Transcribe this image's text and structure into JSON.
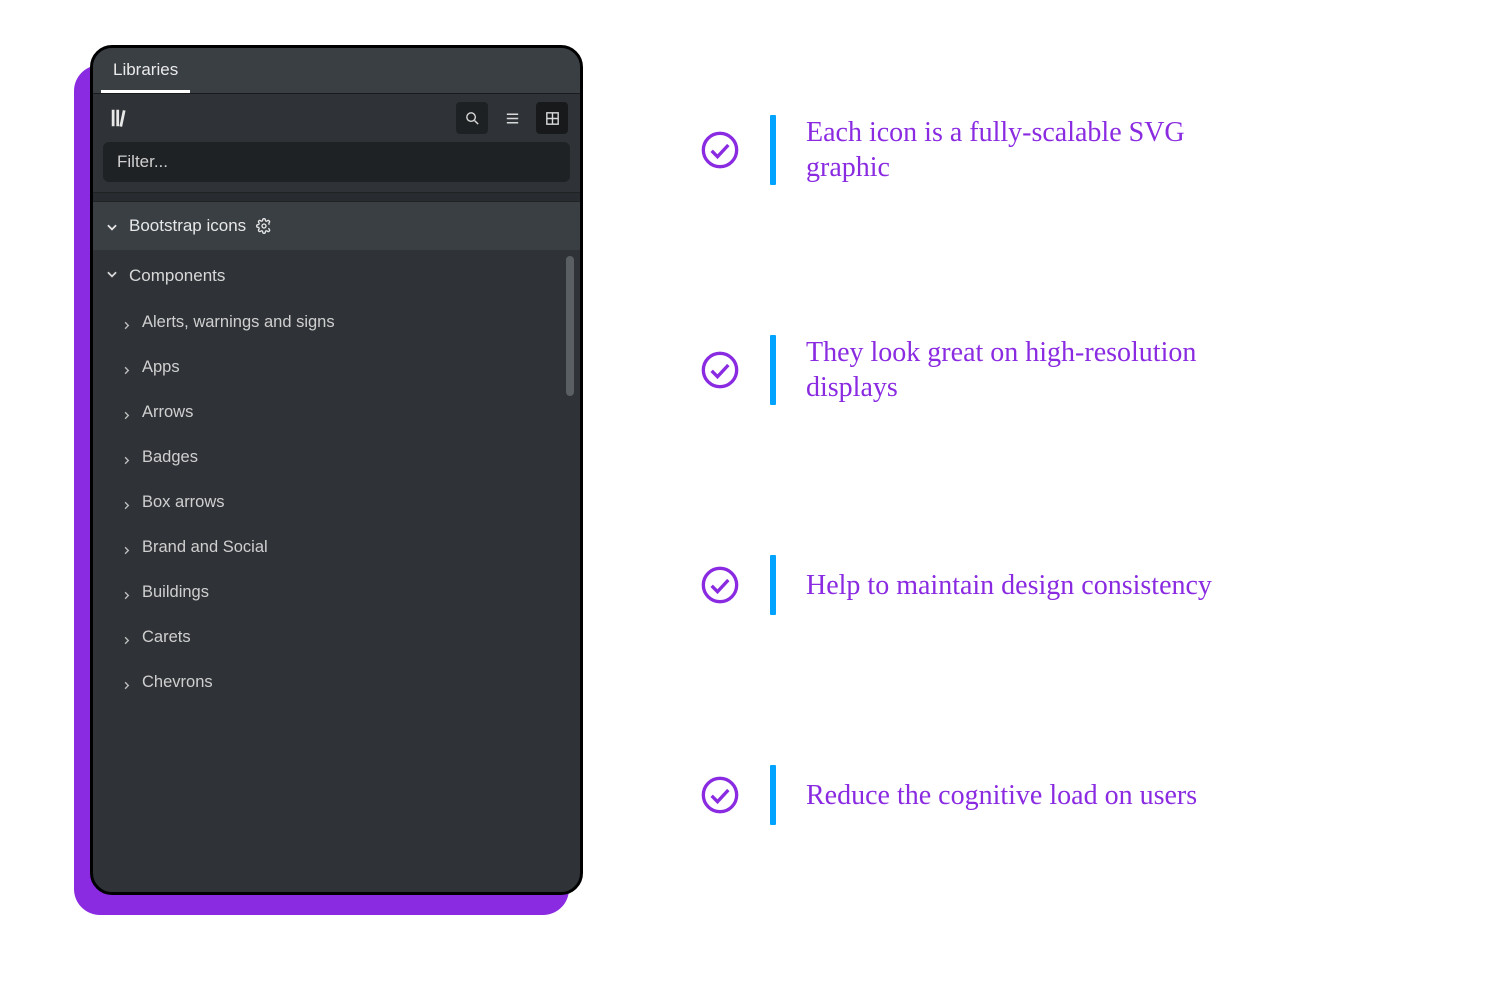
{
  "colors": {
    "purple": "#8a2be2",
    "accent_blue": "#00a3ff",
    "panel_bg": "#2f3337"
  },
  "panel": {
    "tab_label": "Libraries",
    "filter_placeholder": "Filter...",
    "section": {
      "label": "Bootstrap icons"
    },
    "group": {
      "label": "Components",
      "items": [
        "Alerts, warnings and signs",
        "Apps",
        "Arrows",
        "Badges",
        "Box arrows",
        "Brand and Social",
        "Buildings",
        "Carets",
        "Chevrons"
      ]
    }
  },
  "bullets": [
    "Each icon is a fully-scalable SVG graphic",
    "They look great on high-resolution displays",
    "Help to maintain design consistency",
    "Reduce the cognitive load on users"
  ]
}
